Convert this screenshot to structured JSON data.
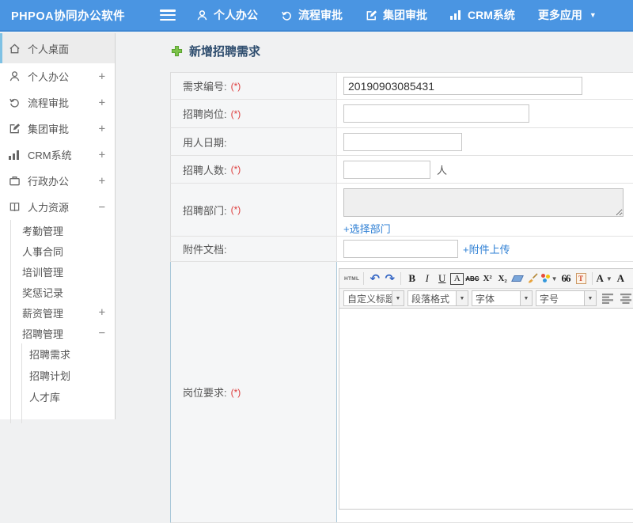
{
  "header": {
    "logo": "PHPOA协同办公软件",
    "nav": [
      {
        "label": "个人办公",
        "icon": "user-icon"
      },
      {
        "label": "流程审批",
        "icon": "process-icon"
      },
      {
        "label": "集团审批",
        "icon": "edit-icon"
      },
      {
        "label": "CRM系统",
        "icon": "bar-chart-icon"
      },
      {
        "label": "更多应用",
        "icon": "caret-down-icon"
      }
    ]
  },
  "sidebar": {
    "items": [
      {
        "label": "个人桌面",
        "icon": "home-icon",
        "active": true
      },
      {
        "label": "个人办公",
        "icon": "user-icon",
        "toggle": "+"
      },
      {
        "label": "流程审批",
        "icon": "process-icon",
        "toggle": "+"
      },
      {
        "label": "集团审批",
        "icon": "edit-icon",
        "toggle": "+"
      },
      {
        "label": "CRM系统",
        "icon": "bar-chart-icon",
        "toggle": "+"
      },
      {
        "label": "行政办公",
        "icon": "briefcase-icon",
        "toggle": "+"
      },
      {
        "label": "人力资源",
        "icon": "book-icon",
        "toggle": "−"
      }
    ],
    "hr_sub": [
      {
        "label": "考勤管理"
      },
      {
        "label": "人事合同"
      },
      {
        "label": "培训管理"
      },
      {
        "label": "奖惩记录"
      },
      {
        "label": "薪资管理",
        "toggle": "+"
      },
      {
        "label": "招聘管理",
        "toggle": "−"
      }
    ],
    "recruit_sub": [
      {
        "label": "招聘需求"
      },
      {
        "label": "招聘计划"
      },
      {
        "label": "人才库"
      }
    ]
  },
  "main": {
    "title": "新增招聘需求",
    "required_mark": "(*)",
    "form": {
      "rows": [
        {
          "label": "需求编号:",
          "required": true,
          "value": "20190903085431"
        },
        {
          "label": "招聘岗位:",
          "required": true,
          "value": ""
        },
        {
          "label": "用人日期:",
          "required": false,
          "value": ""
        },
        {
          "label": "招聘人数:",
          "required": true,
          "value": "",
          "suffix": "人"
        },
        {
          "label": "招聘部门:",
          "required": true,
          "link": "+选择部门"
        },
        {
          "label": "附件文档:",
          "required": false,
          "value": "",
          "link": "+附件上传"
        },
        {
          "label": "岗位要求:",
          "required": true
        }
      ]
    },
    "editor": {
      "glyphs": {
        "html": "HTML",
        "undo": "↶",
        "redo": "↷",
        "bold": "B",
        "italic": "I",
        "underline": "U",
        "font_box": "A",
        "strike": "ABC",
        "sup": "X²",
        "sub": "X₂",
        "quote": "66",
        "paste": "T",
        "color": "A"
      },
      "toolbar_row1_icons": [
        "html-source",
        "undo",
        "redo",
        "bold",
        "italic",
        "underline",
        "font-border-box",
        "strikethrough",
        "superscript",
        "subscript",
        "eraser",
        "format-brush",
        "color-palette",
        "blockquote",
        "paste-from-word",
        "font-color"
      ],
      "toolbar_row2_icons": [
        "heading-select",
        "paragraph-format-select",
        "font-family-select",
        "font-size-select",
        "align-left",
        "align-center",
        "align-right",
        "align-justify"
      ],
      "dropdowns": [
        "自定义标题",
        "段落格式",
        "字体",
        "字号"
      ]
    }
  },
  "colors": {
    "header_blue": "#4a95e2",
    "link_blue": "#2e7fd4",
    "required_red": "#dd3b3b",
    "title_navy": "#2e4d6e",
    "plus_green": "#7cc24a",
    "active_accent": "#7ec1e4"
  }
}
